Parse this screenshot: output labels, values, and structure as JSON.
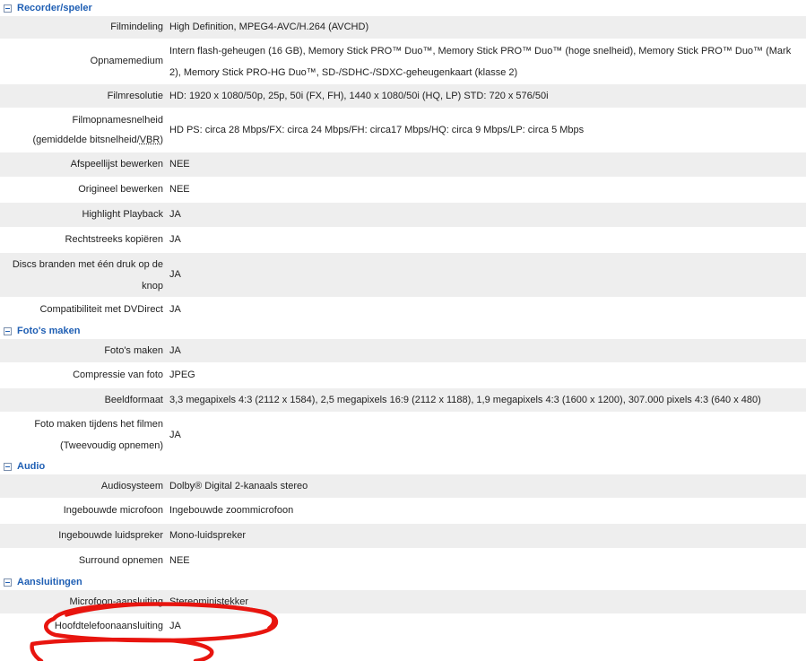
{
  "sections": [
    {
      "title": "Recorder/speler",
      "rows": [
        {
          "label": "Filmindeling",
          "value": "High Definition, MPEG4-AVC/H.264 (AVCHD)"
        },
        {
          "label": "Opnamemedium",
          "value": "Intern flash-geheugen (16 GB), Memory Stick PRO™ Duo™, Memory Stick PRO™ Duo™ (hoge snelheid), Memory Stick PRO™ Duo™ (Mark 2), Memory Stick PRO-HG Duo™, SD-/SDHC-/SDXC-geheugenkaart (klasse 2)"
        },
        {
          "label": "Filmresolutie",
          "value": "HD: 1920 x 1080/50p, 25p, 50i (FX, FH), 1440 x 1080/50i (HQ, LP) STD: 720 x 576/50i"
        },
        {
          "label": "Filmopnamesnelheid (gemiddelde bitsnelheid/VBR)",
          "label_line1": "Filmopnamesnelheid",
          "label_line2_prefix": "(gemiddelde bitsnelheid/",
          "label_line2_abbr": "VBR",
          "label_line2_suffix": ")",
          "value": "HD PS: circa 28 Mbps/FX: circa 24 Mbps/FH: circa17 Mbps/HQ: circa 9 Mbps/LP: circa 5 Mbps"
        },
        {
          "label": "Afspeellijst bewerken",
          "value": "NEE"
        },
        {
          "label": "Origineel bewerken",
          "value": "NEE"
        },
        {
          "label": "Highlight Playback",
          "value": "JA"
        },
        {
          "label": "Rechtstreeks kopiëren",
          "value": "JA"
        },
        {
          "label": "Discs branden met één druk op de knop",
          "value": "JA"
        },
        {
          "label": "Compatibiliteit met DVDirect",
          "value": "JA"
        }
      ]
    },
    {
      "title": "Foto's maken",
      "rows": [
        {
          "label": "Foto's maken",
          "value": "JA"
        },
        {
          "label": "Compressie van foto",
          "value": "JPEG"
        },
        {
          "label": "Beeldformaat",
          "value": "3,3 megapixels 4:3 (2112 x 1584), 2,5 megapixels 16:9 (2112 x 1188), 1,9 megapixels 4:3 (1600 x 1200), 307.000 pixels 4:3 (640 x 480)"
        },
        {
          "label": "Foto maken tijdens het filmen (Tweevoudig opnemen)",
          "value": "JA"
        }
      ]
    },
    {
      "title": "Audio",
      "rows": [
        {
          "label": "Audiosysteem",
          "value": "Dolby® Digital 2-kanaals stereo"
        },
        {
          "label": "Ingebouwde microfoon",
          "value": "Ingebouwde zoommicrofoon"
        },
        {
          "label": "Ingebouwde luidspreker",
          "value": "Mono-luidspreker"
        },
        {
          "label": "Surround opnemen",
          "value": "NEE"
        }
      ]
    },
    {
      "title": "Aansluitingen",
      "rows": [
        {
          "label": "Microfoon-aansluiting",
          "value": "Stereoministekker"
        },
        {
          "label": "Hoofdtelefoonaansluiting",
          "value": "JA"
        }
      ]
    }
  ],
  "colors": {
    "section_title": "#1f5fb4",
    "row_alt_bg": "#eeeeee",
    "annotation": "#e8150f"
  }
}
